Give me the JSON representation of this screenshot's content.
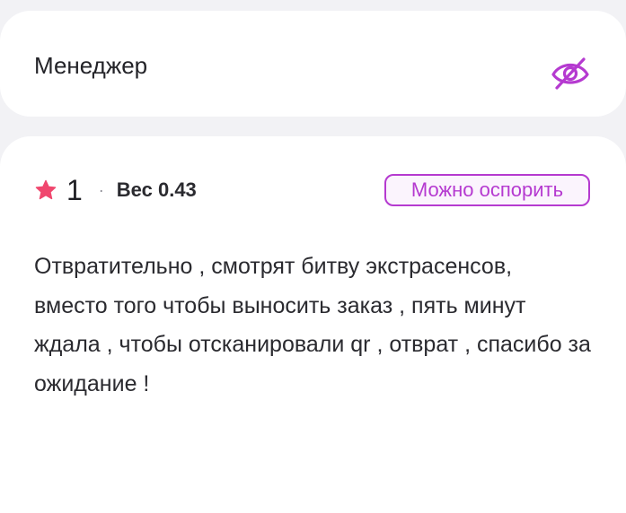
{
  "manager": {
    "title": "Менеджер",
    "visibility_icon": "eye-off-icon",
    "accent_color": "#b53ad0"
  },
  "review": {
    "rating": "1",
    "star_icon": "star-icon",
    "star_color": "#f0476e",
    "separator": "·",
    "weight_label": "Вес 0.43",
    "dispute_label": "Можно оспорить",
    "text": "Отвратительно , смотрят битву экстрасенсов, вместо того чтобы выносить заказ , пять минут ждала , чтобы отсканировали qr , отврат , спасибо за ожидание !"
  }
}
